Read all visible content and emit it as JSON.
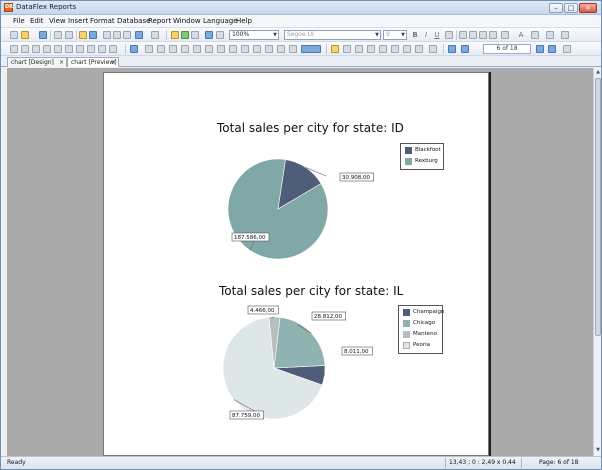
{
  "app": {
    "title": "DataFlex Reports",
    "logo_text": "DR"
  },
  "menu": [
    "File",
    "Edit",
    "View",
    "Insert",
    "Format",
    "Database",
    "Report",
    "Window",
    "Language",
    "Help"
  ],
  "toolbar": {
    "zoom_value": "100%",
    "font_name": "Segoe UI",
    "font_size": "9",
    "bold_label": "B",
    "italic_label": "I",
    "underline_label": "U",
    "font_color_label": "A",
    "page_indicator": "6 of 18"
  },
  "tabs": [
    {
      "label": "chart [Design]",
      "close": "×"
    },
    {
      "label": "chart [Preview]",
      "close": "×"
    }
  ],
  "charts": [
    {
      "title": "Total sales per city for state: ID",
      "slices": [
        {
          "name": "Blackfoot",
          "value": 30908,
          "label": "30.908,00",
          "color": "#4f5d78"
        },
        {
          "name": "Rexburg",
          "value": 187586,
          "label": "187.586,00",
          "color": "#7fa8a6"
        }
      ]
    },
    {
      "title": "Total sales per city for state: IL",
      "slices": [
        {
          "name": "Champaign",
          "value": 8011,
          "label": "8.011,00",
          "color": "#4f5d78"
        },
        {
          "name": "Chicago",
          "value": 28812,
          "label": "28.812,00",
          "color": "#8fb3b1"
        },
        {
          "name": "Manteno",
          "value": 4466,
          "label": "4.466,00",
          "color": "#b8bdbf"
        },
        {
          "name": "Peoria",
          "value": 87759,
          "label": "87.759,00",
          "color": "#dde7e8"
        }
      ]
    }
  ],
  "chart_data": [
    {
      "type": "pie",
      "title": "Total sales per city for state: ID",
      "categories": [
        "Blackfoot",
        "Rexburg"
      ],
      "values": [
        30908,
        187586
      ],
      "legend": "right"
    },
    {
      "type": "pie",
      "title": "Total sales per city for state: IL",
      "categories": [
        "Champaign",
        "Chicago",
        "Manteno",
        "Peoria"
      ],
      "values": [
        8011,
        28812,
        4466,
        87759
      ],
      "legend": "right"
    }
  ],
  "status": {
    "left": "Ready",
    "coords": "13,43 ; 0 : 2,49 x 0,44",
    "page": "Page: 6 of 18"
  },
  "window_controls": {
    "minimize": "–",
    "maximize": "□",
    "close": "×"
  }
}
